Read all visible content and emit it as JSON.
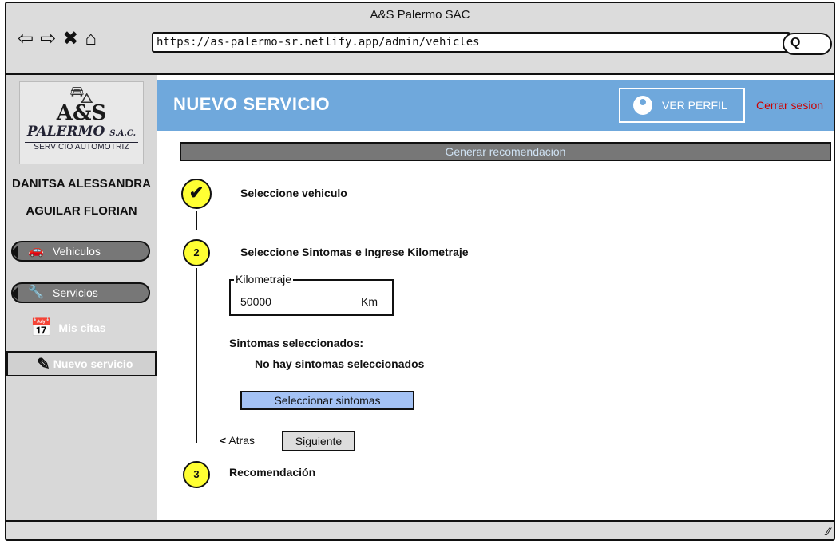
{
  "window": {
    "title": "A&S Palermo SAC"
  },
  "browser": {
    "url": "https://as-palermo-sr.netlify.app/admin/vehicles",
    "nav": {
      "back": "⇦",
      "forward": "⇨",
      "stop": "✖",
      "home": "⌂"
    },
    "search_glyph": "Q"
  },
  "logo": {
    "brand": "A&S",
    "name": "PALERMO",
    "suffix": "S.A.C.",
    "tagline": "SERVICIO AUTOMOTRIZ",
    "car_glyph": "⛍"
  },
  "user": {
    "first_line": "DANITSA ALESSANDRA",
    "second_line": "AGUILAR FLORIAN"
  },
  "sidebar": {
    "vehiculos": {
      "label": "Vehiculos",
      "icon": "car-icon",
      "glyph": "🚗"
    },
    "servicios": {
      "label": "Servicios",
      "icon": "wrench-icon",
      "glyph": "🔧"
    },
    "mis_citas": {
      "label": "Mis citas",
      "icon": "calendar-icon",
      "glyph": "📅"
    },
    "nuevo_servicio": {
      "label": "Nuevo servicio",
      "icon": "edit-icon",
      "glyph": "✎"
    }
  },
  "header": {
    "title": "NUEVO SERVICIO",
    "profile_label": "VER PERFIL",
    "logout_label": "Cerrar sesion",
    "accent": "#6fa8dc",
    "logout_color": "#cc0000"
  },
  "generate_bar": "Generar recomendacion",
  "steps": {
    "one": {
      "marker": "✔",
      "label": "Seleccione vehiculo"
    },
    "two": {
      "marker": "2",
      "label": "Seleccione Sintomas e Ingrese Kilometraje",
      "kilometraje": {
        "label": "Kilometraje",
        "value": "50000",
        "unit": "Km"
      },
      "sintomas_title": "Sintomas seleccionados:",
      "sintomas_empty": "No hay sintomas seleccionados",
      "select_button": "Seleccionar sintomas",
      "back_label": "Atras",
      "back_glyph": "<",
      "next_label": "Siguiente"
    },
    "three": {
      "marker": "3",
      "label": "Recomendación"
    }
  }
}
